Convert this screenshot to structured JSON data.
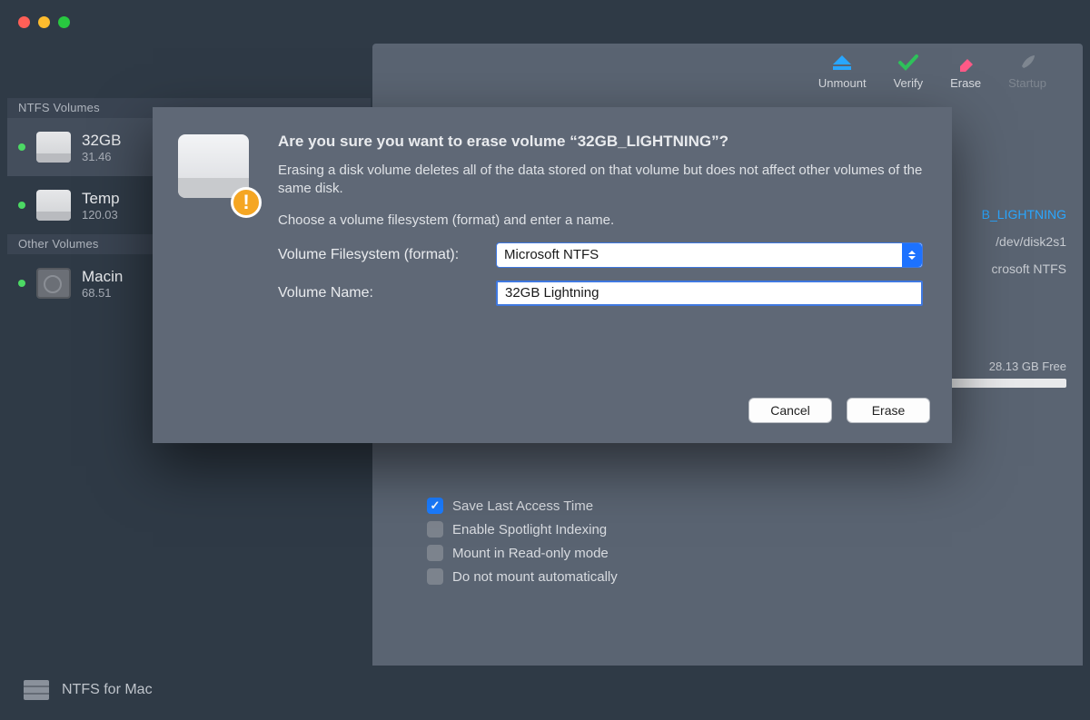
{
  "toolbar": {
    "unmount": "Unmount",
    "verify": "Verify",
    "erase": "Erase",
    "startup": "Startup"
  },
  "sidebar": {
    "section_ntfs": "NTFS Volumes",
    "section_other": "Other Volumes",
    "vols": [
      {
        "title": "32GB",
        "sub": "31.46"
      },
      {
        "title": "Temp",
        "sub": "120.03"
      },
      {
        "title": "Macin",
        "sub": "68.51"
      }
    ]
  },
  "details": {
    "name": "B_LIGHTNING",
    "mount": "/dev/disk2s1",
    "fs": "crosoft NTFS",
    "free": "28.13 GB Free"
  },
  "options": [
    {
      "label": "Save Last Access Time",
      "checked": true
    },
    {
      "label": "Enable Spotlight Indexing",
      "checked": false
    },
    {
      "label": "Mount in Read-only mode",
      "checked": false
    },
    {
      "label": "Do not mount automatically",
      "checked": false
    }
  ],
  "footer": {
    "title": "NTFS for Mac"
  },
  "dialog": {
    "title": "Are you sure you want to erase volume “32GB_LIGHTNING”?",
    "p1": "Erasing a disk volume deletes all of the data stored on that volume but does not affect other volumes of the same disk.",
    "p2": "Choose a volume filesystem (format) and enter a name.",
    "label_fs": "Volume Filesystem (format):",
    "label_name": "Volume Name:",
    "fs_value": "Microsoft NTFS",
    "name_value": "32GB Lightning",
    "cancel": "Cancel",
    "erase": "Erase"
  }
}
